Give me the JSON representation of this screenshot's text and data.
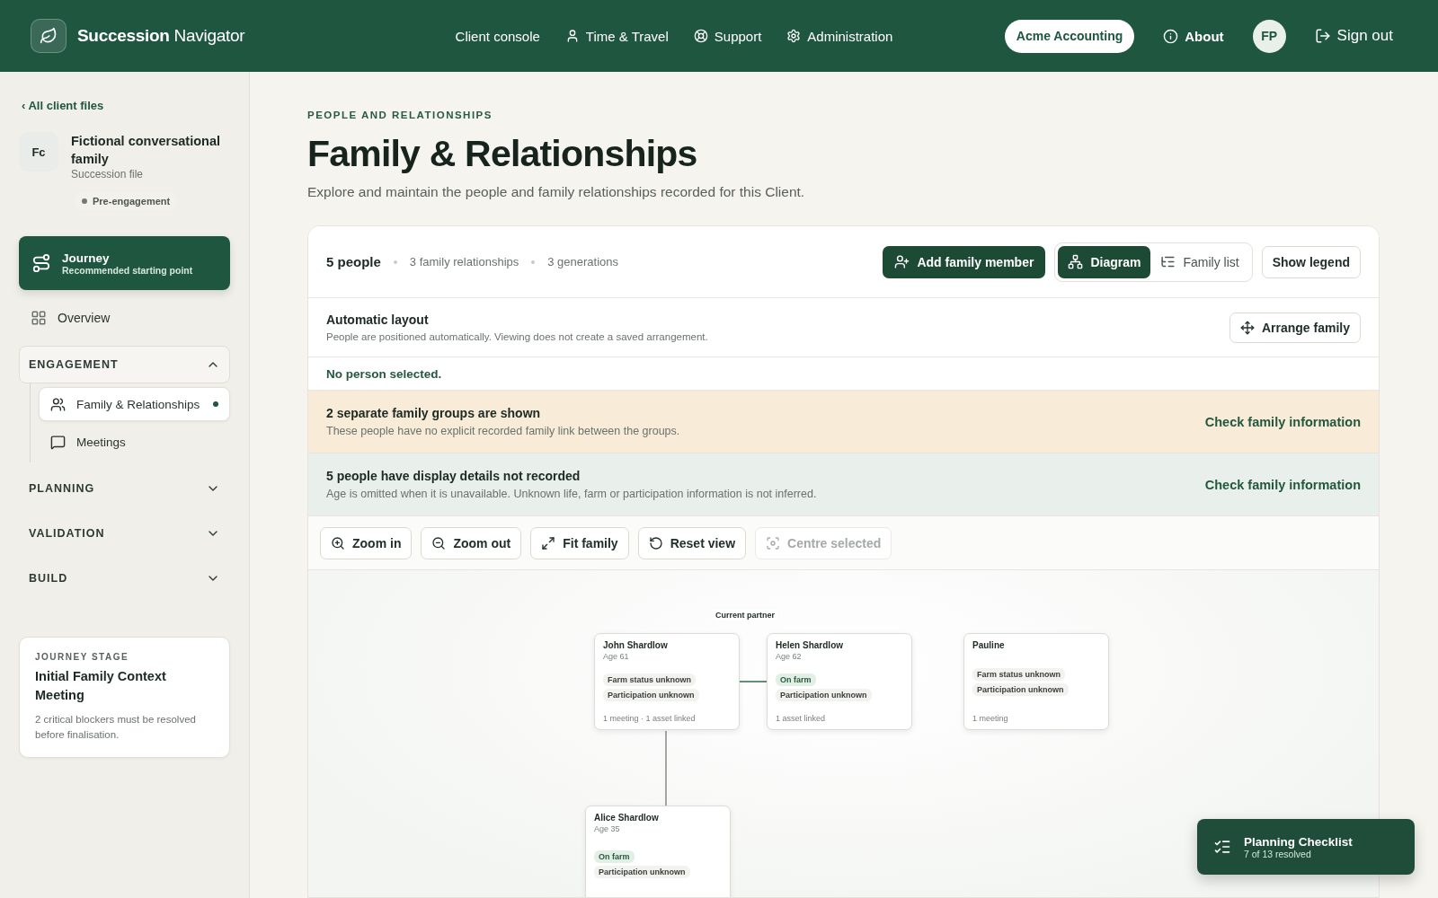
{
  "header": {
    "brand_bold": "Succession",
    "brand_rest": "Navigator",
    "nav": [
      {
        "label": "Client console"
      },
      {
        "label": "Time & Travel"
      },
      {
        "label": "Support"
      },
      {
        "label": "Administration"
      }
    ],
    "organisation": "Acme Accounting",
    "about": "About",
    "avatar": "FP",
    "sign_out": "Sign out"
  },
  "sidebar": {
    "back_link": "‹ All client files",
    "client": {
      "initials": "Fc",
      "name": "Fictional conversational family",
      "subtitle": "Succession file",
      "status": "Pre-engagement"
    },
    "journey": {
      "title": "Journey",
      "subtitle": "Recommended starting point"
    },
    "overview": "Overview",
    "sections": [
      {
        "label": "ENGAGEMENT",
        "expanded": true,
        "items": [
          {
            "label": "Family & Relationships",
            "selected": true
          },
          {
            "label": "Meetings",
            "selected": false
          }
        ]
      },
      {
        "label": "PLANNING",
        "expanded": false
      },
      {
        "label": "VALIDATION",
        "expanded": false
      },
      {
        "label": "BUILD",
        "expanded": false
      }
    ],
    "stage": {
      "eyebrow": "JOURNEY STAGE",
      "title": "Initial Family Context Meeting",
      "note": "2 critical blockers must be resolved before finalisation."
    }
  },
  "page": {
    "eyebrow": "PEOPLE AND RELATIONSHIPS",
    "title": "Family & Relationships",
    "subtitle": "Explore and maintain the people and family relationships recorded for this Client."
  },
  "summary": {
    "people": "5 people",
    "relationships": "3 family relationships",
    "generations": "3 generations",
    "add_button": "Add family member",
    "views": [
      {
        "label": "Diagram",
        "selected": true
      },
      {
        "label": "Family list",
        "selected": false
      }
    ],
    "legend_button": "Show legend"
  },
  "layout": {
    "title": "Automatic layout",
    "note": "People are positioned automatically. Viewing does not create a saved arrangement.",
    "button": "Arrange family"
  },
  "selection": "No person selected.",
  "notices": [
    {
      "kind": "warning",
      "title": "2 separate family groups are shown",
      "note": "These people have no explicit recorded family link between the groups.",
      "action": "Check family information"
    },
    {
      "kind": "info",
      "title": "5 people have display details not recorded",
      "note": "Age is omitted when it is unavailable. Unknown life, farm or participation information is not inferred.",
      "action": "Check family information"
    }
  ],
  "tools": [
    {
      "label": "Zoom in",
      "disabled": false
    },
    {
      "label": "Zoom out",
      "disabled": false
    },
    {
      "label": "Fit family",
      "disabled": false
    },
    {
      "label": "Reset view",
      "disabled": false
    },
    {
      "label": "Centre selected",
      "disabled": true
    }
  ],
  "diagram": {
    "partner_label": "Current partner",
    "people": [
      {
        "name": "John Shardlow",
        "age": "Age 61",
        "chips": [
          {
            "label": "Farm status unknown",
            "kind": "unknown"
          },
          {
            "label": "Participation unknown",
            "kind": "unknown"
          }
        ],
        "footer": "1 meeting · 1 asset linked"
      },
      {
        "name": "Helen Shardlow",
        "age": "Age 62",
        "chips": [
          {
            "label": "On farm",
            "kind": "positive"
          },
          {
            "label": "Participation unknown",
            "kind": "unknown"
          }
        ],
        "footer": "1 asset linked"
      },
      {
        "name": "Pauline",
        "chips": [
          {
            "label": "Farm status unknown",
            "kind": "unknown"
          },
          {
            "label": "Participation unknown",
            "kind": "unknown"
          }
        ],
        "footer": "1 meeting"
      },
      {
        "name": "Alice Shardlow",
        "age": "Age 35",
        "chips": [
          {
            "label": "On farm",
            "kind": "positive"
          },
          {
            "label": "Participation unknown",
            "kind": "unknown"
          }
        ]
      }
    ]
  },
  "checklist": {
    "title": "Planning Checklist",
    "progress": "7 of 13 resolved"
  }
}
